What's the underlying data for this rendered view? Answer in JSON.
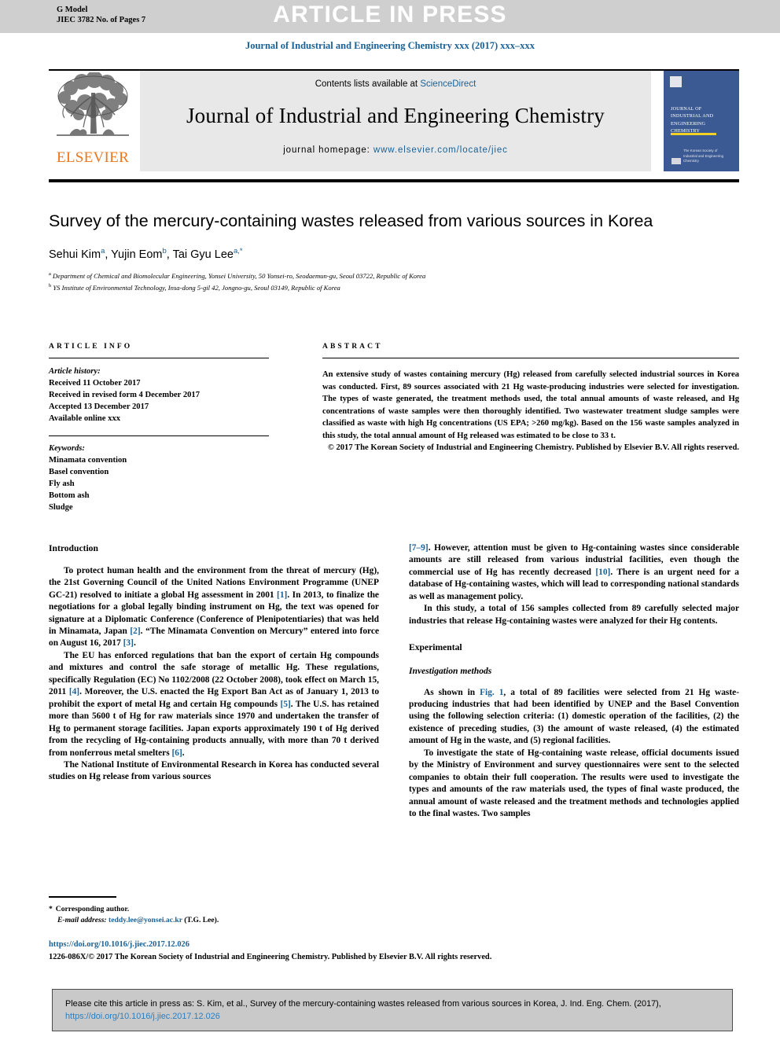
{
  "banner": {
    "gmodel_line1": "G Model",
    "gmodel_line2": "JIEC 3782 No. of Pages 7",
    "article_in_press": "ARTICLE IN PRESS"
  },
  "running_head": "Journal of Industrial and Engineering Chemistry xxx (2017) xxx–xxx",
  "masthead": {
    "publisher_name": "ELSEVIER",
    "contents_prefix": "Contents lists available at ",
    "contents_link": "ScienceDirect",
    "journal_title": "Journal of Industrial and Engineering Chemistry",
    "homepage_label": "journal homepage: ",
    "homepage_url": "www.elsevier.com/locate/jiec",
    "cover_title": "Journal of Industrial and Engineering Chemistry",
    "cover_footer": "The Korean Society of Industrial and Engineering Chemistry"
  },
  "article": {
    "title": "Survey of the mercury-containing wastes released from various sources in Korea",
    "authors_html": "Sehui Kim<sup>a</sup>, Yujin Eom<sup>b</sup>, Tai Gyu Lee<sup>a,*</sup>",
    "affiliation_a": "Department of Chemical and Biomolecular Engineering, Yonsei University, 50 Yonsei-ro, Seodaemun-gu, Seoul 03722, Republic of Korea",
    "affiliation_b": "YS Institute of Environmental Technology, Insa-dong 5-gil 42, Jongno-gu, Seoul 03149, Republic of Korea"
  },
  "article_info": {
    "heading": "ARTICLE INFO",
    "history_label": "Article history:",
    "history": [
      "Received 11 October 2017",
      "Received in revised form 4 December 2017",
      "Accepted 13 December 2017",
      "Available online xxx"
    ],
    "keywords_label": "Keywords:",
    "keywords": [
      "Minamata convention",
      "Basel convention",
      "Fly ash",
      "Bottom ash",
      "Sludge"
    ]
  },
  "abstract": {
    "heading": "ABSTRACT",
    "body": "An extensive study of wastes containing mercury (Hg) released from carefully selected industrial sources in Korea was conducted. First, 89 sources associated with 21 Hg waste-producing industries were selected for investigation. The types of waste generated, the treatment methods used, the total annual amounts of waste released, and Hg concentrations of waste samples were then thoroughly identified. Two wastewater treatment sludge samples were classified as waste with high Hg concentrations (US EPA; >260 mg/kg). Based on the 156 waste samples analyzed in this study, the total annual amount of Hg released was estimated to be close to 33 t.",
    "copyright": "© 2017 The Korean Society of Industrial and Engineering Chemistry. Published by Elsevier B.V. All rights reserved."
  },
  "body": {
    "intro_heading": "Introduction",
    "experimental_heading": "Experimental",
    "investigation_heading": "Investigation methods",
    "left_p1_a": "To protect human health and the environment from the threat of mercury (Hg), the 21st Governing Council of the United Nations Environment Programme (UNEP GC-21) resolved to initiate a global Hg assessment in 2001 ",
    "left_p1_r1": "[1]",
    "left_p1_b": ". In 2013, to finalize the negotiations for a global legally binding instrument on Hg, the text was opened for signature at a Diplomatic Conference (Conference of Plenipotentiaries) that was held in Minamata, Japan ",
    "left_p1_r2": "[2]",
    "left_p1_c": ". “The Minamata Convention on Mercury” entered into force on August 16, 2017 ",
    "left_p1_r3": "[3]",
    "left_p1_d": ".",
    "left_p2_a": "The EU has enforced regulations that ban the export of certain Hg compounds and mixtures and control the safe storage of metallic Hg. These regulations, specifically Regulation (EC) No 1102/2008 (22 October 2008), took effect on March 15, 2011 ",
    "left_p2_r1": "[4]",
    "left_p2_b": ". Moreover, the U.S. enacted the Hg Export Ban Act as of January 1, 2013 to prohibit the export of metal Hg and certain Hg compounds ",
    "left_p2_r2": "[5]",
    "left_p2_c": ". The U.S. has retained more than 5600 t of Hg for raw materials since 1970 and undertaken the transfer of Hg to permanent storage facilities. Japan exports approximately 190 t of Hg derived from the recycling of Hg-containing products annually, with more than 70 t derived from nonferrous metal smelters ",
    "left_p2_r3": "[6]",
    "left_p2_d": ".",
    "left_p3": "The National Institute of Environmental Research in Korea has conducted several studies on Hg release from various sources",
    "right_p1_r1": "[7–9]",
    "right_p1_a": ". However, attention must be given to Hg-containing wastes since considerable amounts are still released from various industrial facilities, even though the commercial use of Hg has recently decreased ",
    "right_p1_r2": "[10]",
    "right_p1_b": ". There is an urgent need for a database of Hg-containing wastes, which will lead to corresponding national standards as well as management policy.",
    "right_p2": "In this study, a total of 156 samples collected from 89 carefully selected major industries that release Hg-containing wastes were analyzed for their Hg contents.",
    "right_p3_a": "As shown in ",
    "right_p3_fig": "Fig. 1",
    "right_p3_b": ", a total of 89 facilities were selected from 21 Hg waste-producing industries that had been identified by UNEP and the Basel Convention using the following selection criteria: (1) domestic operation of the facilities, (2) the existence of preceding studies, (3) the amount of waste released, (4) the estimated amount of Hg in the waste, and (5) regional facilities.",
    "right_p4": "To investigate the state of Hg-containing waste release, official documents issued by the Ministry of Environment and survey questionnaires were sent to the selected companies to obtain their full cooperation. The results were used to investigate the types and amounts of the raw materials used, the types of final waste produced, the annual amount of waste released and the treatment methods and technologies applied to the final wastes. Two samples"
  },
  "footnote": {
    "corresponding": "Corresponding author.",
    "email_label": "E-mail address:",
    "email": "teddy.lee@yonsei.ac.kr",
    "email_owner": "(T.G. Lee)."
  },
  "footer": {
    "doi": "https://doi.org/10.1016/j.jiec.2017.12.026",
    "copyright_line": "1226-086X/© 2017 The Korean Society of Industrial and Engineering Chemistry. Published by Elsevier B.V. All rights reserved."
  },
  "cite_box": {
    "text": "Please cite this article in press as: S. Kim, et al., Survey of the mercury-containing wastes released from various sources in Korea, J. Ind. Eng. Chem. (2017), ",
    "link": "https://doi.org/10.1016/j.jiec.2017.12.026"
  },
  "colors": {
    "link_blue": "#1a6196",
    "elsevier_orange": "#E87722",
    "cover_blue": "#3b5a93",
    "banner_gray": "#cfcfcf",
    "masthead_gray": "#e8e8e8",
    "cite_gray": "#c9c9c9"
  }
}
